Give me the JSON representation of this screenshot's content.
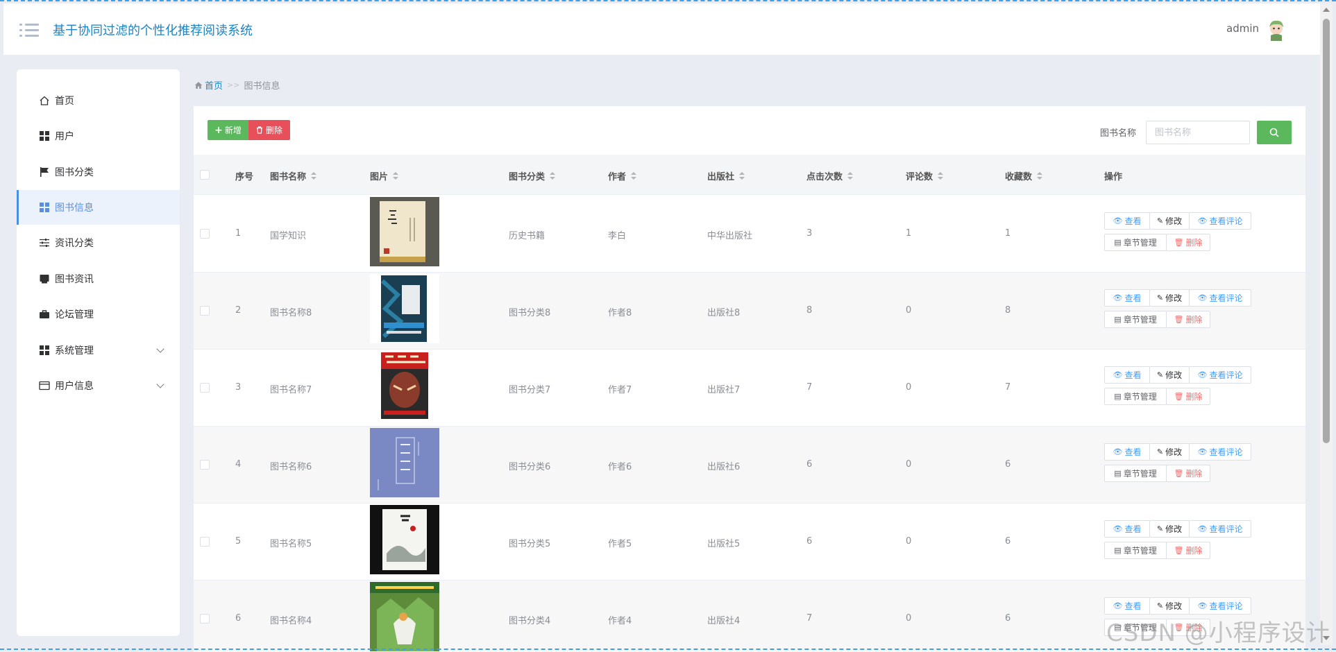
{
  "header": {
    "title": "基于协同过滤的个性化推荐阅读系统",
    "user": "admin"
  },
  "sidebar": {
    "items": [
      {
        "label": "首页",
        "icon": "home-icon"
      },
      {
        "label": "用户",
        "icon": "grid-icon"
      },
      {
        "label": "图书分类",
        "icon": "flag-icon"
      },
      {
        "label": "图书信息",
        "icon": "grid-icon",
        "active": true
      },
      {
        "label": "资讯分类",
        "icon": "sliders-icon"
      },
      {
        "label": "图书资讯",
        "icon": "tablet-icon"
      },
      {
        "label": "论坛管理",
        "icon": "briefcase-icon"
      },
      {
        "label": "系统管理",
        "icon": "grid-icon",
        "expandable": true
      },
      {
        "label": "用户信息",
        "icon": "card-icon",
        "expandable": true
      }
    ]
  },
  "breadcrumb": {
    "home": "首页",
    "separator": ">>",
    "current": "图书信息"
  },
  "toolbar": {
    "add_label": "新增",
    "delete_label": "删除",
    "search_label": "图书名称",
    "search_placeholder": "图书名称"
  },
  "table": {
    "columns": [
      "序号",
      "图书名称",
      "图片",
      "图书分类",
      "作者",
      "出版社",
      "点击次数",
      "评论数",
      "收藏数",
      "操作"
    ],
    "rows": [
      {
        "index": "1",
        "name": "国学知识",
        "category": "历史书籍",
        "author": "李白",
        "publisher": "中华出版社",
        "clicks": "3",
        "comments": "1",
        "favorites": "1",
        "cover": "cover-1"
      },
      {
        "index": "2",
        "name": "图书名称8",
        "category": "图书分类8",
        "author": "作者8",
        "publisher": "出版社8",
        "clicks": "8",
        "comments": "0",
        "favorites": "8",
        "cover": "cover-2"
      },
      {
        "index": "3",
        "name": "图书名称7",
        "category": "图书分类7",
        "author": "作者7",
        "publisher": "出版社7",
        "clicks": "7",
        "comments": "0",
        "favorites": "7",
        "cover": "cover-3"
      },
      {
        "index": "4",
        "name": "图书名称6",
        "category": "图书分类6",
        "author": "作者6",
        "publisher": "出版社6",
        "clicks": "6",
        "comments": "0",
        "favorites": "6",
        "cover": "cover-4"
      },
      {
        "index": "5",
        "name": "图书名称5",
        "category": "图书分类5",
        "author": "作者5",
        "publisher": "出版社5",
        "clicks": "6",
        "comments": "0",
        "favorites": "6",
        "cover": "cover-5"
      },
      {
        "index": "6",
        "name": "图书名称4",
        "category": "图书分类4",
        "author": "作者4",
        "publisher": "出版社4",
        "clicks": "7",
        "comments": "0",
        "favorites": "6",
        "cover": "cover-6"
      }
    ],
    "actions": {
      "view": "查看",
      "edit": "修改",
      "comments": "查看评论",
      "chapters": "章节管理",
      "delete": "删除"
    }
  },
  "watermark": "CSDN @小程序设计",
  "colors": {
    "brand": "#1d84c6",
    "add": "#5cb85c",
    "danger": "#e7505a",
    "link": "#409eff",
    "active_nav": "#5a8ee0"
  }
}
